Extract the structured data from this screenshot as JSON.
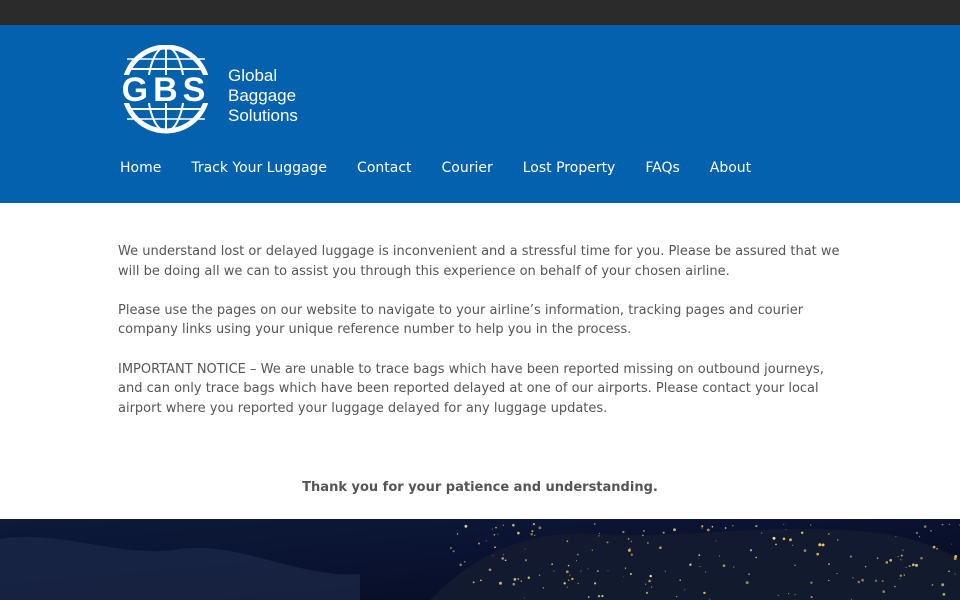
{
  "brand": {
    "logo_letters": "GBS",
    "name_lines": [
      "Global",
      "Baggage",
      "Solutions"
    ]
  },
  "nav": {
    "items": [
      "Home",
      "Track Your Luggage",
      "Contact",
      "Courier",
      "Lost Property",
      "FAQs",
      "About"
    ]
  },
  "content": {
    "paragraphs": [
      "We understand lost or delayed luggage is inconvenient and a stressful time for you. Please be assured that we will be doing all we can to assist you through this experience on behalf of your chosen airline.",
      "Please use the pages on our website to navigate to your airline’s information, tracking pages and courier company links using your unique reference number to help you in the process.",
      "IMPORTANT NOTICE – We are unable to trace bags which have been reported missing on outbound journeys, and can only trace bags which have been reported delayed at one of our airports. Please contact your local airport where you reported your luggage delayed for any luggage updates."
    ],
    "thanks": "Thank you for your patience and understanding."
  },
  "colors": {
    "topbar": "#2b2b2b",
    "header": "#0361ad",
    "text": "#555555"
  }
}
